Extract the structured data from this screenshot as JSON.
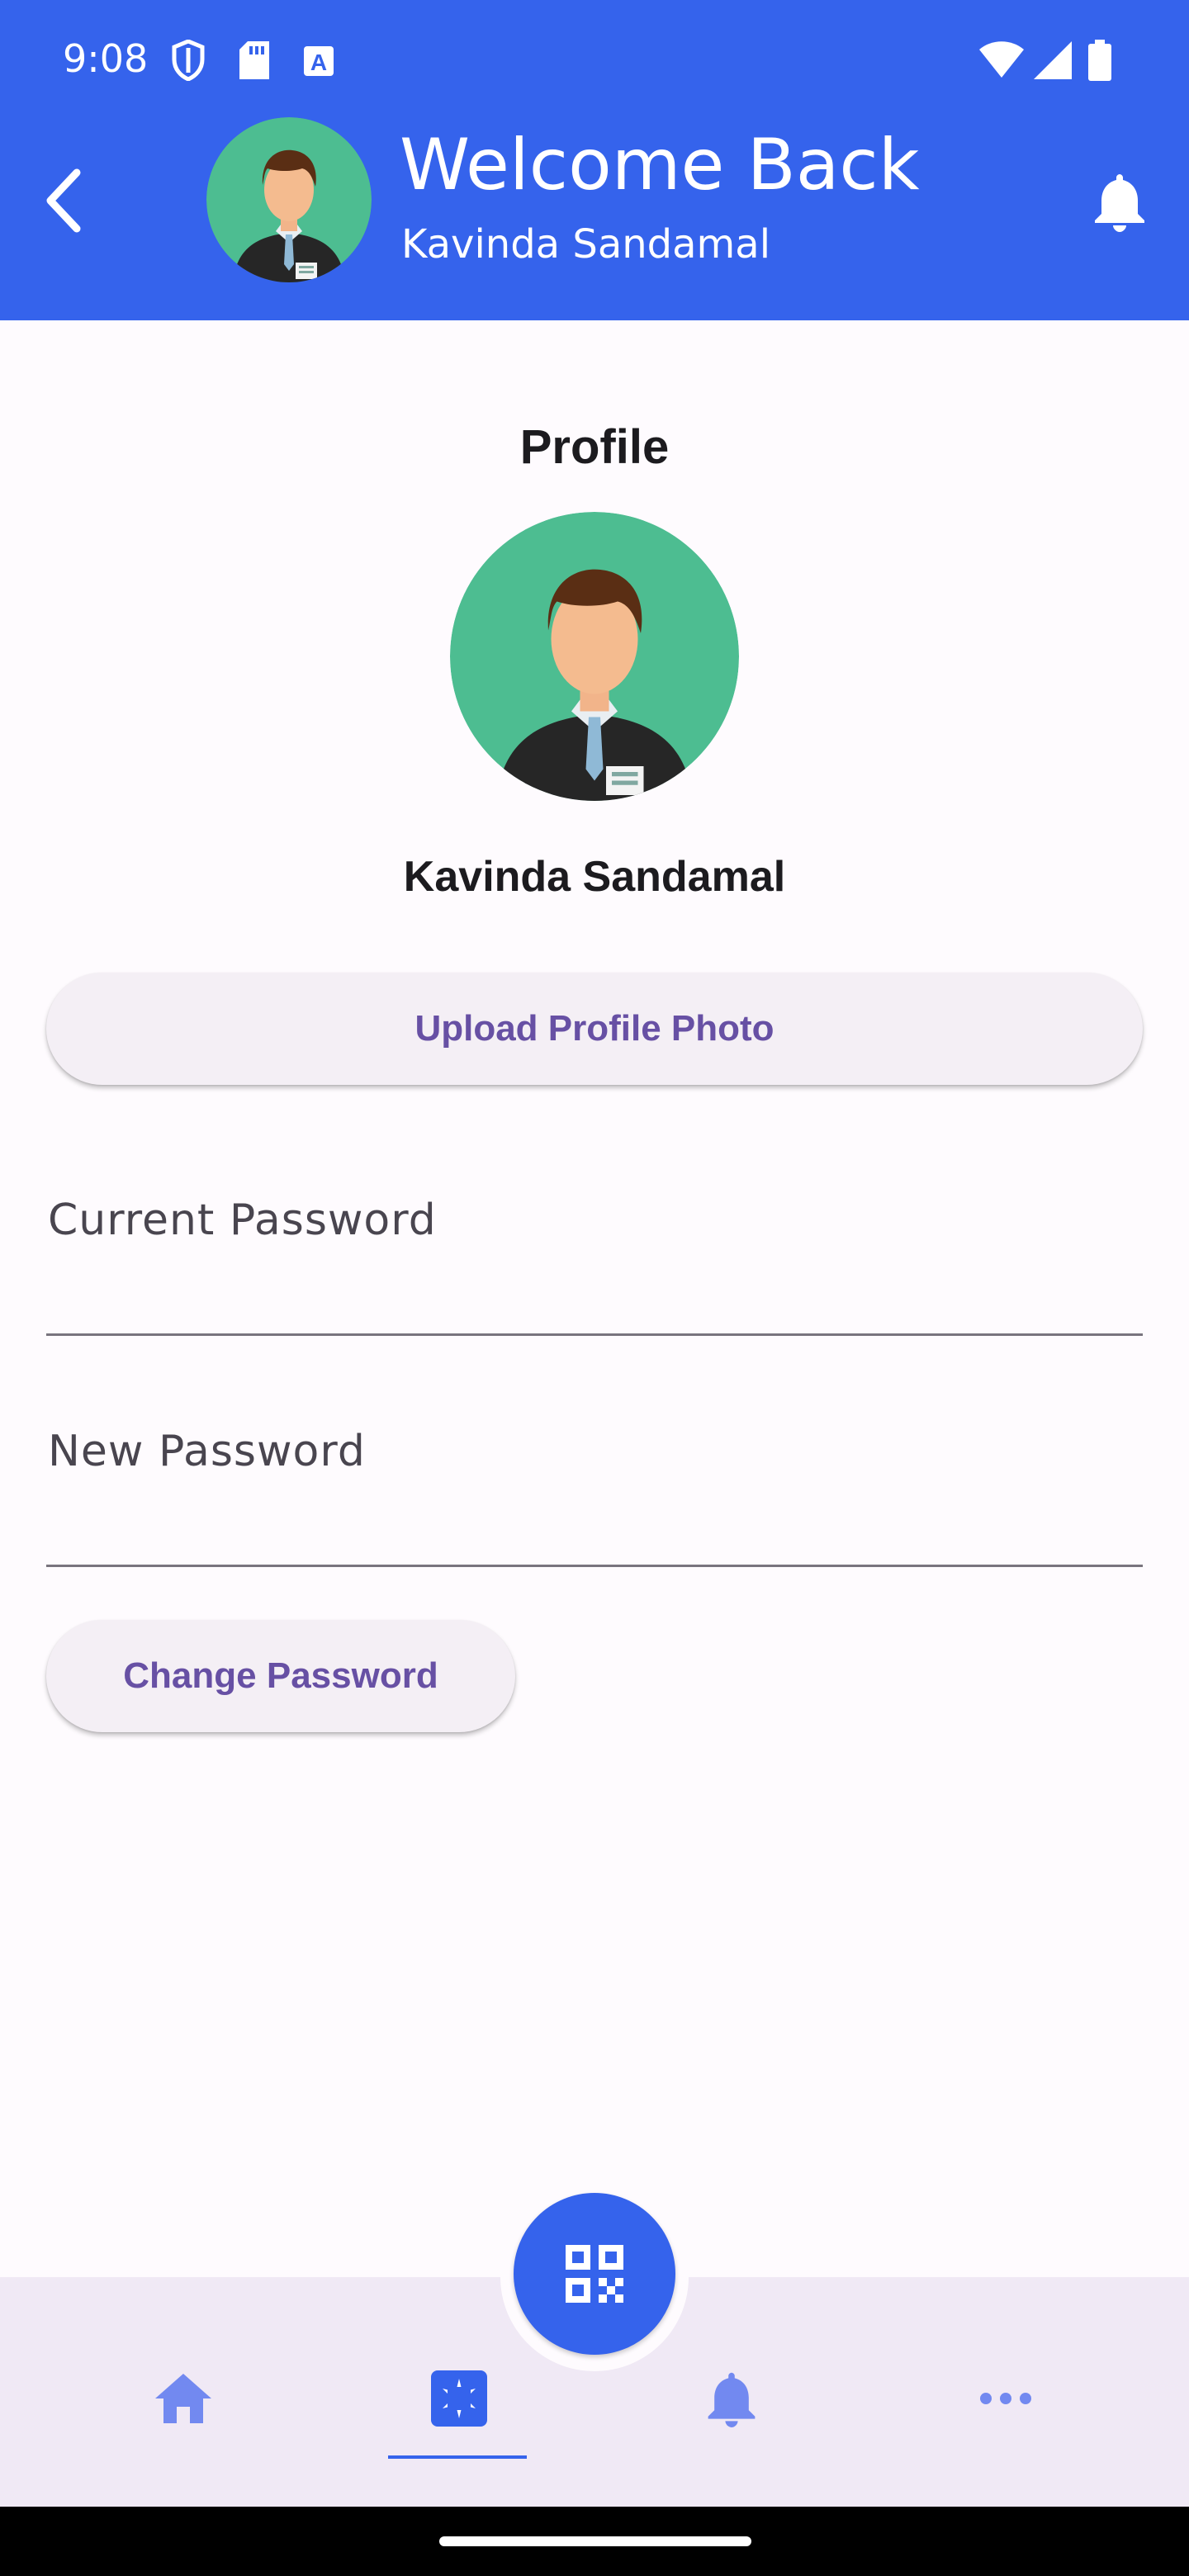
{
  "status_bar": {
    "time": "9:08",
    "left_icons": [
      "shield-icon",
      "sd-card-icon",
      "text-a-icon"
    ],
    "right_icons": [
      "wifi-icon",
      "signal-icon",
      "battery-icon"
    ]
  },
  "header": {
    "title": "Welcome Back",
    "subtitle": "Kavinda Sandamal",
    "background": "#3563ec"
  },
  "profile": {
    "title": "Profile",
    "name": "Kavinda Sandamal",
    "upload_label": "Upload Profile Photo"
  },
  "form": {
    "current_password_label": "Current Password",
    "new_password_label": "New Password",
    "change_label": "Change Password"
  },
  "bottom_nav": {
    "items": [
      {
        "icon": "home-icon",
        "active": false
      },
      {
        "icon": "apps-icon",
        "active": true
      },
      {
        "icon": "bell-icon",
        "active": false
      },
      {
        "icon": "more-icon",
        "active": false
      }
    ],
    "fab_icon": "qr-code-icon",
    "accent": "#3563ec"
  },
  "colors": {
    "primary": "#3563ec",
    "button_text": "#6750a4",
    "avatar_bg": "#4dbd91"
  }
}
